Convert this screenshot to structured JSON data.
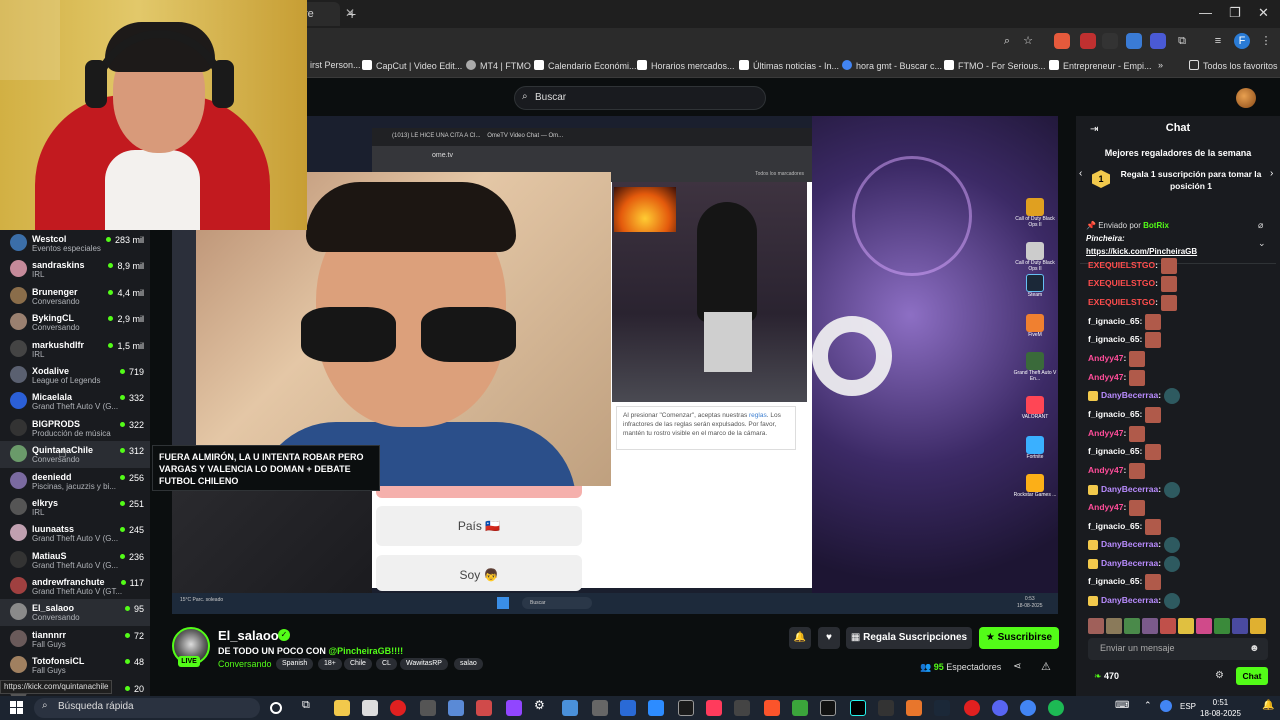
{
  "browser": {
    "tab_text": "re",
    "address_placeholder": "",
    "bookmarks": [
      {
        "label": "irst Person...",
        "color": "#555555"
      },
      {
        "label": "CapCut | Video Edit...",
        "color": "#ffffff"
      },
      {
        "label": "MT4 | FTMO",
        "color": "#aaaaaa"
      },
      {
        "label": "Calendario Económi...",
        "color": "#ffffff"
      },
      {
        "label": "Horarios mercados...",
        "color": "#ffffff"
      },
      {
        "label": "Últimas noticias - In...",
        "color": "#ffffff"
      },
      {
        "label": "hora gmt - Buscar c...",
        "color": "#4285f4"
      },
      {
        "label": "FTMO - For Serious...",
        "color": "#ffffff"
      },
      {
        "label": "Entrepreneur - Empi...",
        "color": "#ffffff"
      }
    ],
    "all_bookmarks": "Todos los favoritos"
  },
  "kick": {
    "search_placeholder": "Buscar"
  },
  "sidebar": {
    "channels": [
      {
        "name": "Westcol",
        "category": "Eventos especiales",
        "viewers": "283 mil",
        "color": "#3b6ea8"
      },
      {
        "name": "sandraskins",
        "category": "IRL",
        "viewers": "8,9 mil",
        "color": "#c58a9a"
      },
      {
        "name": "Brunenger",
        "category": "Conversando",
        "viewers": "4,4 mil",
        "color": "#8a6d4a"
      },
      {
        "name": "BykingCL",
        "category": "Conversando",
        "viewers": "2,9 mil",
        "color": "#9a8070"
      },
      {
        "name": "markushdlfr",
        "category": "IRL",
        "viewers": "1,5 mil",
        "color": "#444444"
      },
      {
        "name": "Xodalive",
        "category": "League of Legends",
        "viewers": "719",
        "color": "#5a6070"
      },
      {
        "name": "Micaelala",
        "category": "Grand Theft Auto V (G...",
        "viewers": "332",
        "color": "#2b5fd6"
      },
      {
        "name": "BIGPRODS",
        "category": "Producción de música",
        "viewers": "322",
        "color": "#333333"
      },
      {
        "name": "QuintanaChile",
        "category": "Conversando",
        "viewers": "312",
        "color": "#6a9a6a"
      },
      {
        "name": "deeniedd",
        "category": "Piscinas, jacuzzis y bi...",
        "viewers": "256",
        "color": "#7a6aa0"
      },
      {
        "name": "elkrys",
        "category": "IRL",
        "viewers": "251",
        "color": "#555555"
      },
      {
        "name": "luunaatss",
        "category": "Grand Theft Auto V (G...",
        "viewers": "245",
        "color": "#c0a0b0"
      },
      {
        "name": "MatiauS",
        "category": "Grand Theft Auto V (G...",
        "viewers": "236",
        "color": "#333333"
      },
      {
        "name": "andrewfranchute",
        "category": "Grand Theft Auto V (GT...",
        "viewers": "117",
        "color": "#a04040"
      },
      {
        "name": "El_salaoo",
        "category": "Conversando",
        "viewers": "95",
        "color": "#8a8a8a"
      },
      {
        "name": "tiannnrr",
        "category": "Fall Guys",
        "viewers": "72",
        "color": "#6a5a5a"
      },
      {
        "name": "TotofonsiCL",
        "category": "Fall Guys",
        "viewers": "48",
        "color": "#a08060"
      },
      {
        "name": "",
        "category": "",
        "viewers": "20",
        "color": "#555555"
      }
    ],
    "tooltip": "FUERA ALMIRÓN, LA U INTENTA ROBAR PERO VARGAS Y VALENCIA LO DOMAN + DEBATE FUTBOL CHILENO",
    "status_url": "https://kick.com/quintanachile"
  },
  "stream": {
    "inner_tab1": "(1013) LE HICE UNA CITA A CI...",
    "inner_tab2": "OmeTV Video Chat — Om...",
    "inner_address": "ome.tv",
    "inner_bookmarks": "Todos los marcadores",
    "consent_text_1": "Al presionar \"Comenzar\", aceptas nuestras ",
    "consent_link": "reglas",
    "consent_text_2": ". Los infractores de las reglas serán expulsados. Por favor, mantén tu rostro visible en el marco de la cámara.",
    "country_button": "País 🇨🇱",
    "gender_button": "Soy 👦",
    "desktop_icons": [
      {
        "label": "Call of Duty Black Ops II",
        "color": "#e0a020"
      },
      {
        "label": "Call of Duty Black Ops II",
        "color": "#ccc"
      },
      {
        "label": "Steam",
        "color": "#1b2838"
      },
      {
        "label": "FiveM",
        "color": "#f08030"
      },
      {
        "label": "Grand Theft Auto V En...",
        "color": "#3a6a3a"
      },
      {
        "label": "VALORANT",
        "color": "#ff4655"
      },
      {
        "label": "Fortnite",
        "color": "#3ab0ff"
      },
      {
        "label": "Rockstar Games ...",
        "color": "#fcaf17"
      }
    ],
    "inner_taskbar_search": "Buscar",
    "inner_weather": "15°C Parc. soleado",
    "inner_time": "0:53",
    "inner_date": "18-08-2025"
  },
  "streamer": {
    "live_label": "LIVE",
    "username": "El_salaoo",
    "title_prefix": "DE TODO UN POCO CON ",
    "title_mention": "@PincheiraGB!!!!",
    "category": "Conversando",
    "tags": [
      "Spanish",
      "18+",
      "Chile",
      "CL",
      "WawitasRP",
      "salao"
    ],
    "viewers_count": "95",
    "viewers_label": "Espectadores",
    "gift_button": "Regala Suscripciones",
    "subscribe_button": "Suscribirse"
  },
  "chat": {
    "title": "Chat",
    "gifters_title": "Mejores regaladores de la semana",
    "gift_rank": "1",
    "gift_text": "Regala 1 suscripción para tomar la posición 1",
    "pinned_by_prefix": "Enviado por",
    "pinned_by": "BotRix",
    "pinned_user": "Pincheira:",
    "pinned_link": "https://kick.com/PincheiraGB",
    "messages": [
      {
        "user": "EXEQUIELSTGO",
        "color": "#ff4d4d",
        "badge": false
      },
      {
        "user": "EXEQUIELSTGO",
        "color": "#ff4d4d",
        "badge": false
      },
      {
        "user": "EXEQUIELSTGO",
        "color": "#ff4d4d",
        "badge": false
      },
      {
        "user": "f_ignacio_65",
        "color": "#ffffff",
        "badge": false
      },
      {
        "user": "Andyy47",
        "color": "#ff4d9a",
        "badge": false
      },
      {
        "user": "Andyy47",
        "color": "#ff4d9a",
        "badge": false
      },
      {
        "user": "DanyBecerraa",
        "color": "#b98cff",
        "badge": true
      },
      {
        "user": "f_ignacio_65",
        "color": "#ffffff",
        "badge": false
      },
      {
        "user": "Andyy47",
        "color": "#ff4d9a",
        "badge": false
      },
      {
        "user": "f_ignacio_65",
        "color": "#ffffff",
        "badge": false
      },
      {
        "user": "Andyy47",
        "color": "#ff4d9a",
        "badge": false
      },
      {
        "user": "DanyBecerraa",
        "color": "#b98cff",
        "badge": true
      },
      {
        "user": "Andyy47",
        "color": "#ff4d9a",
        "badge": false
      },
      {
        "user": "f_ignacio_65",
        "color": "#ffffff",
        "badge": false
      },
      {
        "user": "DanyBecerraa",
        "color": "#b98cff",
        "badge": true
      },
      {
        "user": "DanyBecerraa",
        "color": "#b98cff",
        "badge": true
      },
      {
        "user": "f_ignacio_65",
        "color": "#ffffff",
        "badge": false
      },
      {
        "user": "DanyBecerraa",
        "color": "#b98cff",
        "badge": true
      }
    ],
    "input_placeholder": "Enviar un mensaje",
    "points": "470",
    "send_button": "Chat"
  },
  "taskbar": {
    "search_placeholder": "Búsqueda rápida",
    "language": "ESP",
    "time": "0:51",
    "date": "18-08-2025"
  },
  "colors": {
    "accent": "#53fc18",
    "bg": "#0b0e0f",
    "panel": "#191b1f"
  }
}
